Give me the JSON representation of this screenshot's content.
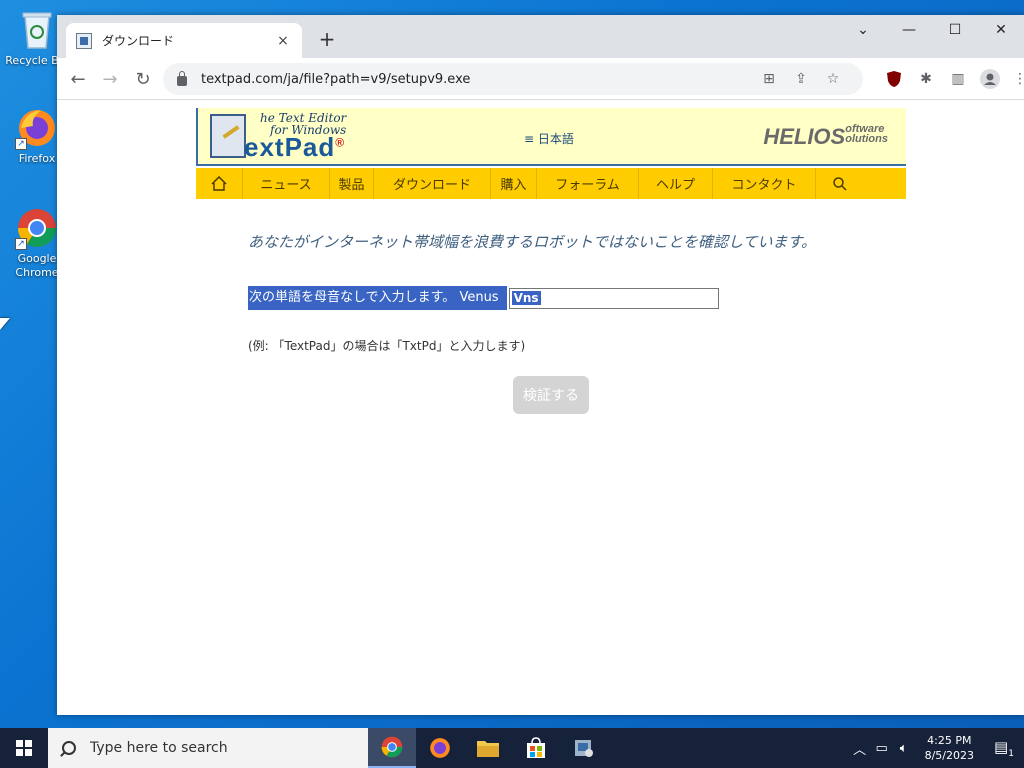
{
  "desktop": {
    "icons": [
      {
        "label": "Recycle Bin",
        "icon": "recycle-bin-icon"
      },
      {
        "label": "Firefox",
        "icon": "firefox-icon"
      },
      {
        "label": "Google Chrome",
        "icon": "chrome-icon"
      }
    ]
  },
  "browser": {
    "tab_title": "ダウンロード",
    "tab_close": "×",
    "new_tab": "+",
    "window_controls": {
      "minimize": "⌄",
      "restore": "—",
      "maximize": "☐",
      "close": "✕"
    },
    "url": "textpad.com/ja/file?path=v9/setupv9.exe"
  },
  "site": {
    "logo_tagline_1": "he Text Editor",
    "logo_tagline_2": "for Windows",
    "logo_name": "extPad",
    "logo_reg": "®",
    "language": "≡ 日本語",
    "brand": "HELIOS",
    "brand_suffix_1": "oftware",
    "brand_suffix_2": "olutions",
    "nav": [
      "ニュース",
      "製品",
      "ダウンロード",
      "購入",
      "フォーラム",
      "ヘルプ",
      "コンタクト"
    ],
    "notice": "あなたがインターネット帯域幅を浪費するロボットではないことを確認しています。",
    "prompt_label": "次の単語を母音なしで入力します。 Venus",
    "answer_value": "Vns",
    "example": "(例: 「TextPad」の場合は「TxtPd」と入力します)",
    "verify_button": "検証する"
  },
  "taskbar": {
    "search_placeholder": "Type here to search",
    "time": "4:25 PM",
    "date": "8/5/2023",
    "notification_count": "1"
  },
  "colors": {
    "header_bg": "#ffffc6",
    "nav_bg": "#ffcc00",
    "selection": "#3a64c4",
    "desktop": "#0b73d1"
  }
}
